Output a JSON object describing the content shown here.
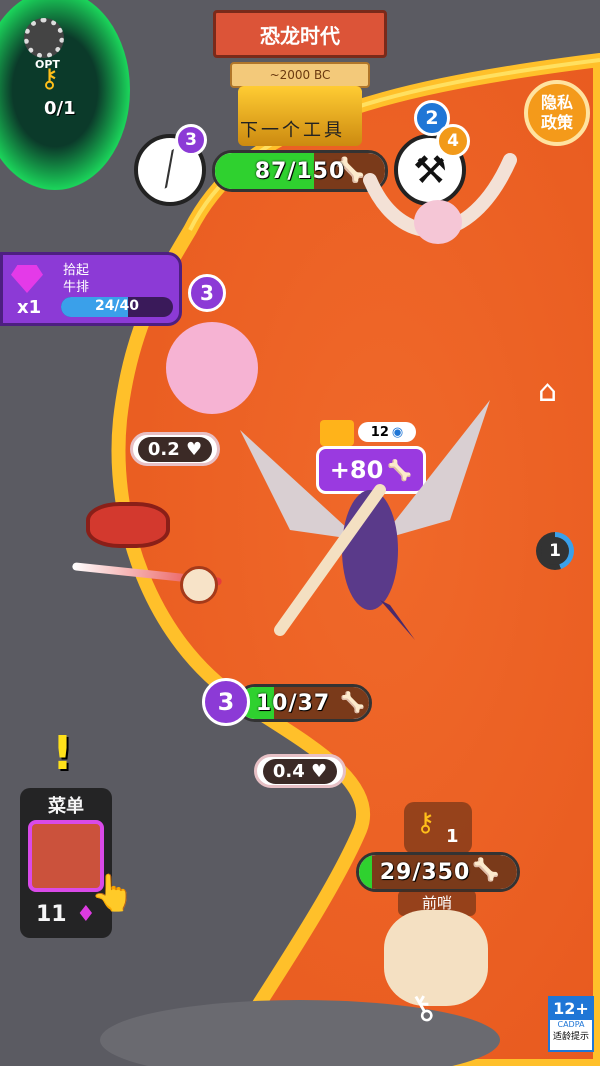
{
  "colors": {
    "lava": "#f0692a",
    "lava_edge": "#ffb020",
    "ground": "#5b5b62",
    "progress_green": "#2fd12f",
    "purple": "#8c3ad6",
    "blue_badge": "#1f76d6",
    "orange_badge": "#f29a1a"
  },
  "header": {
    "era_title": "恐龙时代",
    "era_subtitle": "~2000 BC",
    "next_tool_label": "下一个工具",
    "progress_text": "87/150",
    "progress_fraction": 0.58,
    "tool_left_level": "3",
    "tool_right_level_blue": "2",
    "tool_right_level_orange": "4"
  },
  "portal": {
    "opt_label": "OPT",
    "key_count": "0/1"
  },
  "privacy_button": {
    "label_line1": "隐私",
    "label_line2": "政策"
  },
  "quest": {
    "title_line1": "拾起",
    "title_line2": "牛排",
    "multiplier": "x1",
    "progress_text": "24/40",
    "progress_fraction": 0.6
  },
  "sheep": {
    "level": "3",
    "heart_text": "0.2"
  },
  "player": {
    "gain_text": "+80",
    "small_counter": "12",
    "level": "3",
    "progress_text": "10/37",
    "progress_fraction": 0.27,
    "heart_text": "0.4"
  },
  "side": {
    "counter": "1",
    "home_icon": "home-icon"
  },
  "outpost": {
    "key_count": "1",
    "progress_text": "29/350",
    "progress_fraction": 0.08,
    "label": "前哨"
  },
  "menu": {
    "label": "菜单",
    "gem_count": "11",
    "alert": "!"
  },
  "age_rating": {
    "rating": "12+",
    "org": "CADPA",
    "caption": "适龄提示"
  }
}
